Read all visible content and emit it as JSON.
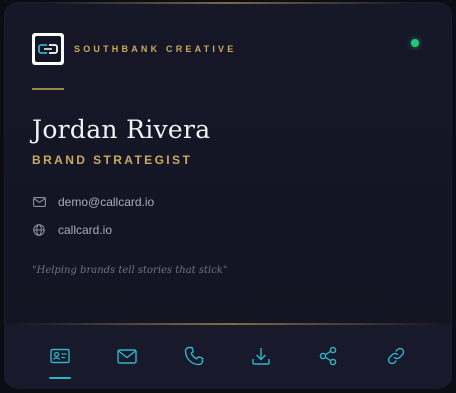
{
  "header": {
    "company": "SOUTHBANK CREATIVE",
    "logo_icon": "brand-logo-icon",
    "status": "online",
    "status_color": "#22c77a"
  },
  "profile": {
    "name": "Jordan Rivera",
    "title": "BRAND STRATEGIST"
  },
  "contacts": [
    {
      "icon": "mail-icon",
      "value": "demo@callcard.io"
    },
    {
      "icon": "globe-icon",
      "value": "callcard.io"
    }
  ],
  "quote": "\"Helping brands tell stories that stick\"",
  "actions": [
    {
      "icon": "contact-card-icon",
      "active": true
    },
    {
      "icon": "mail-icon",
      "active": false
    },
    {
      "icon": "phone-icon",
      "active": false
    },
    {
      "icon": "download-icon",
      "active": false
    },
    {
      "icon": "share-icon",
      "active": false
    },
    {
      "icon": "link-icon",
      "active": false
    }
  ],
  "colors": {
    "accent_gold": "#c9a85f",
    "accent_teal": "#2bb5c8",
    "background": "#141524"
  }
}
